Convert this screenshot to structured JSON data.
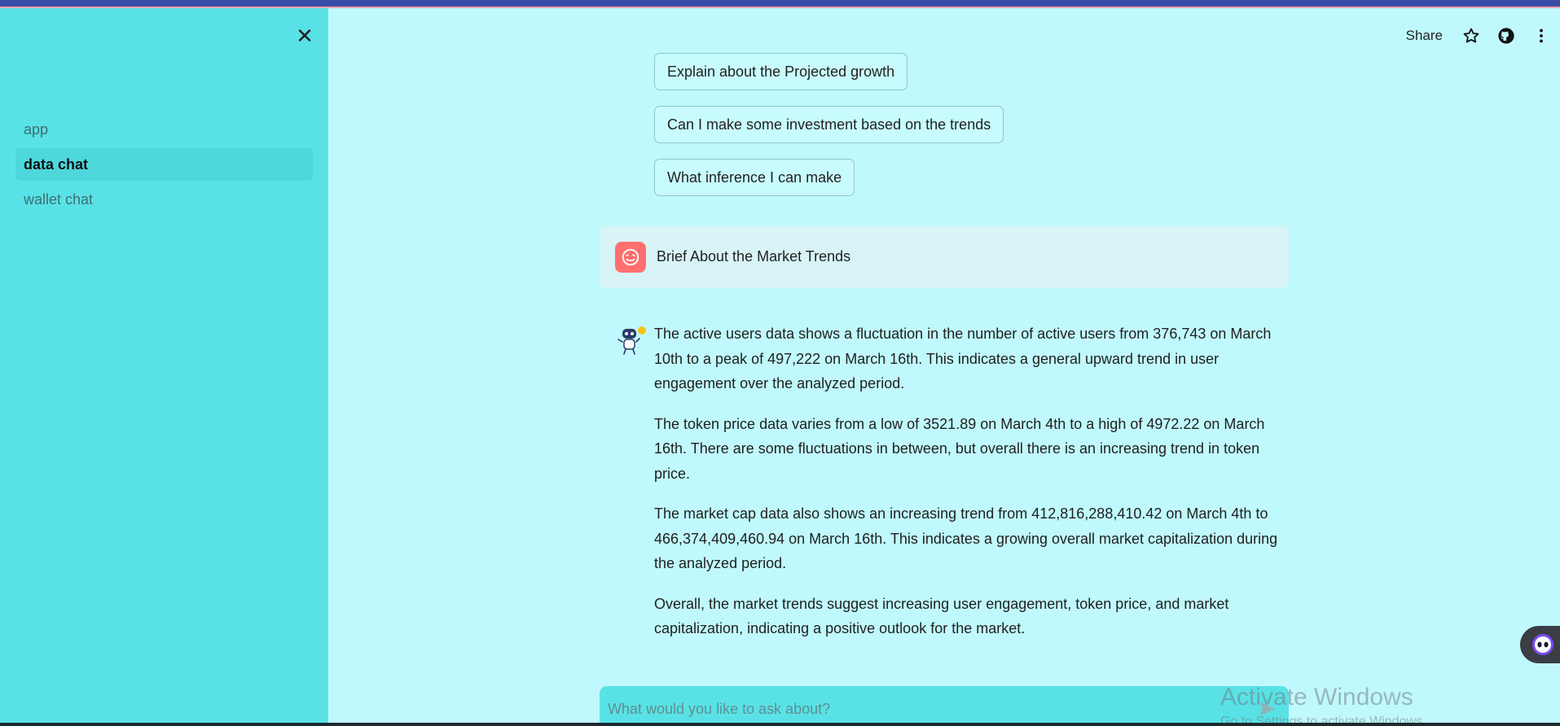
{
  "sidebar": {
    "close_icon": "close-icon",
    "nav": [
      {
        "label": "app",
        "active": false
      },
      {
        "label": "data chat",
        "active": true
      },
      {
        "label": "wallet chat",
        "active": false
      }
    ]
  },
  "header": {
    "share_label": "Share",
    "icons": [
      "star-icon",
      "github-icon",
      "more-vertical-icon"
    ]
  },
  "chat": {
    "suggestions": [
      "Explain about the Projected growth",
      "Can I make some investment based on the trends",
      "What inference I can make"
    ],
    "user_message": "Brief About the Market Trends",
    "assistant_paragraphs": [
      "The active users data shows a fluctuation in the number of active users from 376,743 on March 10th to a peak of 497,222 on March 16th. This indicates a general upward trend in user engagement over the analyzed period.",
      "The token price data varies from a low of 3521.89 on March 4th to a high of 4972.22 on March 16th. There are some fluctuations in between, but overall there is an increasing trend in token price.",
      "The market cap data also shows an increasing trend from 412,816,288,410.42 on March 4th to 466,374,409,460.94 on March 16th. This indicates a growing overall market capitalization during the analyzed period.",
      "Overall, the market trends suggest increasing user engagement, token price, and market capitalization, indicating a positive outlook for the market."
    ],
    "input_placeholder": "What would you like to ask about?"
  },
  "watermark": {
    "line1": "Activate Windows",
    "line2": "Go to Settings to activate Windows."
  },
  "colors": {
    "sidebar_bg": "#59e2e6",
    "main_bg": "#c0f9fd",
    "user_avatar": "#ff6f6f",
    "user_msg_bg": "#d8f4f6"
  }
}
